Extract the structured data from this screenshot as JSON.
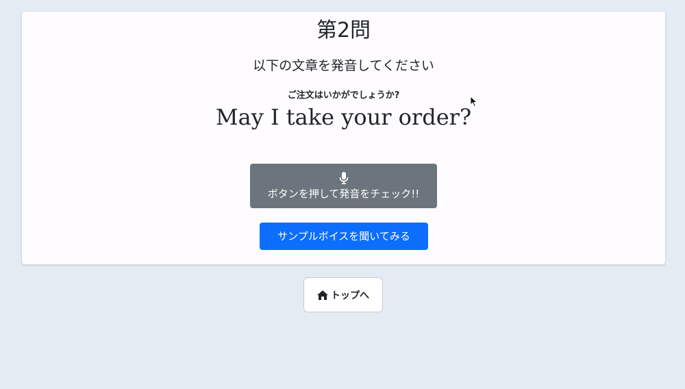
{
  "quiz": {
    "title": "第2問",
    "instruction": "以下の文章を発音してください",
    "translation": "ご注文はいかがでしょうか?",
    "sentence": "May I take your order?"
  },
  "buttons": {
    "record_label": "ボタンを押して発音をチェック!!",
    "sample_label": "サンプルボイスを聞いてみる",
    "top_label": "トップへ"
  },
  "icons": {
    "record": "microphone-icon",
    "top": "home-icon"
  },
  "colors": {
    "background": "#e4ebf3",
    "card": "#fefcfe",
    "record_button": "#6c757d",
    "sample_button": "#0d6efd"
  }
}
